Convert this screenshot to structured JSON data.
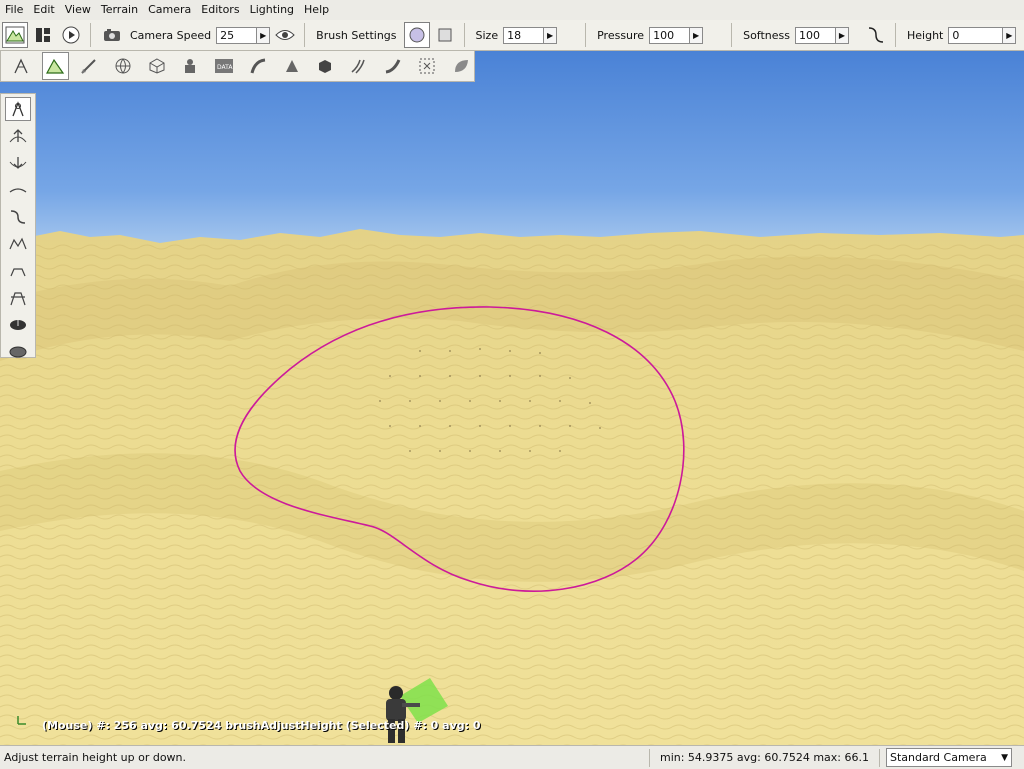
{
  "menu": [
    "File",
    "Edit",
    "View",
    "Terrain",
    "Camera",
    "Editors",
    "Lighting",
    "Help"
  ],
  "toolbar": {
    "camera_speed_label": "Camera Speed",
    "camera_speed_value": "25",
    "brush_settings_label": "Brush Settings",
    "size_label": "Size",
    "size_value": "18",
    "pressure_label": "Pressure",
    "pressure_value": "100",
    "softness_label": "Softness",
    "softness_value": "100",
    "height_label": "Height",
    "height_value": "0"
  },
  "editor_tools": [
    "object-editor-icon",
    "terrain-editor-icon",
    "terrain-painter-icon",
    "world-icon",
    "mesh-icon",
    "decal-icon",
    "datablock-icon",
    "road-icon",
    "forest-icon",
    "shape-icon",
    "river-icon",
    "mesh-road-icon",
    "navmesh-icon",
    "leaf-icon"
  ],
  "terrain_tools": [
    "select-brush-icon",
    "raise-height-icon",
    "lower-height-icon",
    "smooth-icon",
    "paint-noise-icon",
    "flatten-icon",
    "set-height-icon",
    "clear-terrain-icon",
    "paint-empty-icon",
    "restore-icon"
  ],
  "viewport": {
    "hud_text": "(Mouse) #: 256  avg: 60.7524 brushAdjustHeight  (Selected) #: 0  avg: 0"
  },
  "status": {
    "message": "Adjust terrain height up or down.",
    "stats": "min: 54.9375  avg: 60.7524  max: 66.1",
    "camera": "Standard Camera"
  },
  "colors": {
    "sky_top": "#4f86d9",
    "sky_horizon": "#a7c8ee",
    "sand": "#e9d98a",
    "brush_outline": "#cc1a9a"
  }
}
